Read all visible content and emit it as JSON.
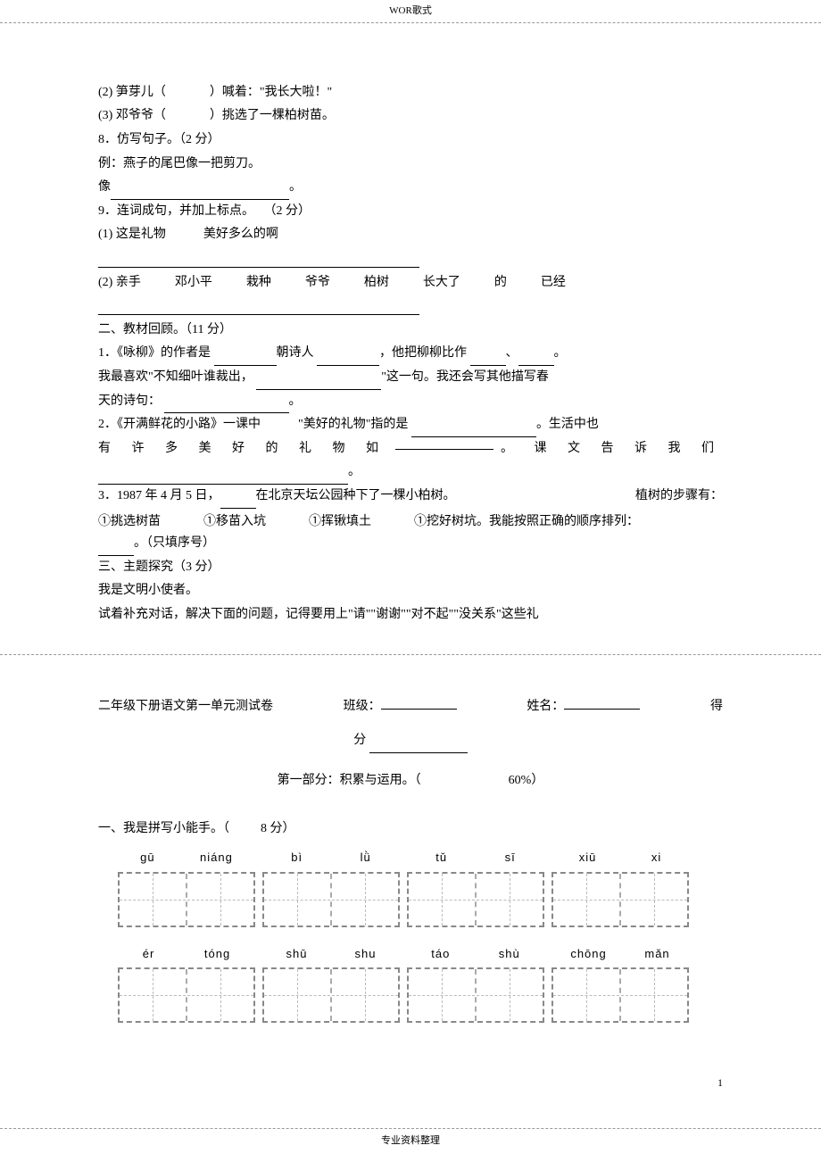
{
  "header": "WOR歌式",
  "footer": "专业资料整理",
  "page_number": "1",
  "lines": {
    "l2": "(2)  笋芽儿（",
    "l2b": "）喊着：\"我长大啦！\"",
    "l3": "(3)  邓爷爷（",
    "l3b": "）挑选了一棵柏树苗。",
    "q8": "8．仿写句子。（2 分）",
    "q8ex": "例：燕子的尾巴像一把剪刀。",
    "q8like": "像",
    "q8end": "。",
    "q9": "9．连词成句，并加上标点。",
    "q9pts": "（2 分）",
    "q9_1a": "(1)  这是礼物",
    "q9_1b": "美好多么的啊",
    "q9_2": {
      "a": "(2) 亲手",
      "b": "邓小平",
      "c": "栽种",
      "d": "爷爷",
      "e": "柏树",
      "f": "长大了",
      "g": "的",
      "h": "已经"
    },
    "sec2": "二、教材回顾。（11 分）",
    "s2_1a": "1．《咏柳》的作者是",
    "s2_1b": "朝诗人",
    "s2_1c": "，他把柳柳比作",
    "s2_1d": "、",
    "s2_1e": "。",
    "s2_1f": "我最喜欢\"不知细叶谁裁出，",
    "s2_1g": "\"这一句。我还会写其他描写春",
    "s2_1h": "天的诗句：",
    "s2_1i": "。",
    "s2_2a": "2．《开满鲜花的小路》一课中",
    "s2_2b": "\"美好的礼物\"指的是",
    "s2_2c": "。生活中也",
    "s2_2d": "有 许 多 美 好 的 礼 物 如",
    "s2_2e": "。 课 文 告 诉 我 们",
    "s2_2f": "。",
    "s2_3a": "3．1987 年 4 月 5 日，",
    "s2_3b": "在北京天坛公园种下了一棵小柏树。",
    "s2_3c": "植树的步骤有：",
    "s2_3d": "①挑选树苗",
    "s2_3e": "①移苗入坑",
    "s2_3f": "①挥锹填土",
    "s2_3g": "①挖好树坑。我能按照正确的顺序排列：",
    "s2_3h": "。（只填序号）",
    "sec3": "三、主题探究（3 分）",
    "s3_1": "我是文明小使者。",
    "s3_2": "试着补充对话，解决下面的问题，记得要用上\"请\"\"谢谢\"\"对不起\"\"没关系\"这些礼",
    "test_title": "二年级下册语文第一单元测试卷",
    "class_lbl": "班级：",
    "name_lbl": "姓名：",
    "score_lbl_right": "得",
    "score_lbl": "分",
    "part1": "第一部分：积累与运用。（",
    "part1pct": "60%）",
    "q_a1": "一、我是拼写小能手。（",
    "q_a1pts": "8 分）",
    "pinyin_row1": {
      "g1a": "ɡū",
      "g1b": "niánɡ",
      "g2a": "bì",
      "g2b": "lǜ",
      "g3a": "tǔ",
      "g3b": "sī",
      "g4a": "xiū",
      "g4b": "xi"
    },
    "pinyin_row2": {
      "g1a": "ér",
      "g1b": "tónɡ",
      "g2a": "shū",
      "g2b": "shu",
      "g3a": "táo",
      "g3b": "shù",
      "g4a": "chōnɡ",
      "g4b": "mǎn"
    }
  }
}
